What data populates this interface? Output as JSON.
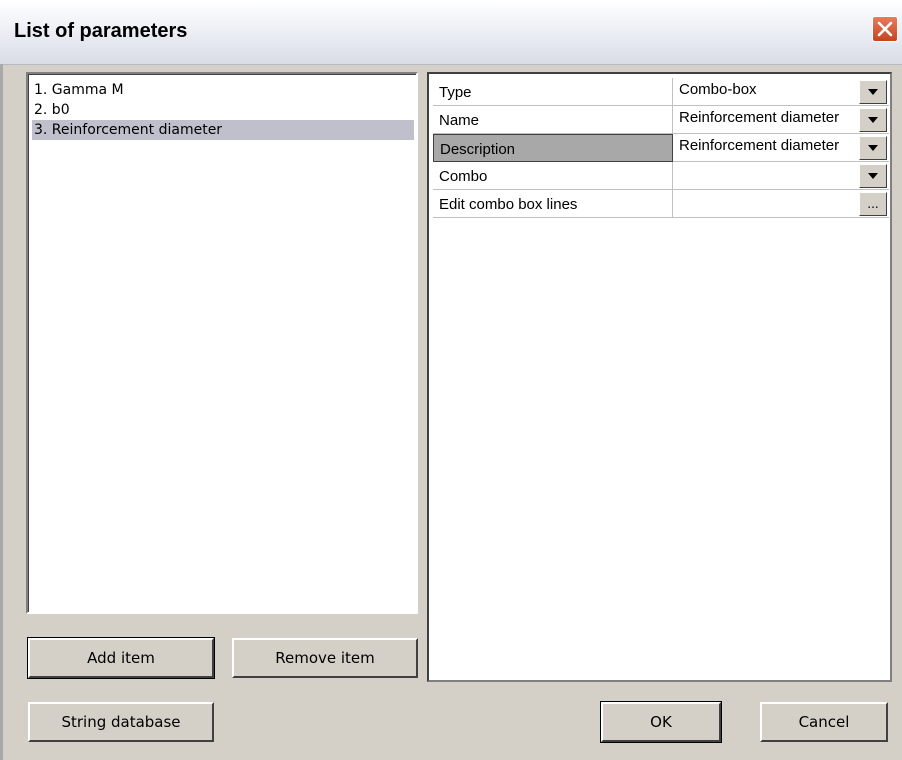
{
  "window": {
    "title": "List of parameters"
  },
  "list": {
    "items": [
      {
        "label": "1. Gamma M",
        "selected": false
      },
      {
        "label": "2. b0",
        "selected": false
      },
      {
        "label": "3. Reinforcement diameter",
        "selected": true
      }
    ]
  },
  "properties": {
    "rows": [
      {
        "name": "Type",
        "value": "Combo-box",
        "control": "dropdown"
      },
      {
        "name": "Name",
        "value": "Reinforcement diameter",
        "control": "dropdown"
      },
      {
        "name": "Description",
        "value": "Reinforcement diameter",
        "control": "dropdown",
        "highlighted": true
      },
      {
        "name": "Combo",
        "value": "",
        "control": "dropdown"
      },
      {
        "name": "Edit combo box lines",
        "value": "",
        "control": "ellipsis",
        "button_text": "..."
      }
    ]
  },
  "buttons": {
    "add": "Add item",
    "remove": "Remove item",
    "string_db": "String database",
    "ok": "OK",
    "cancel": "Cancel"
  },
  "icons": {
    "close": "close-icon",
    "dropdown": "chevron-down-icon",
    "ellipsis": "ellipsis-icon"
  }
}
